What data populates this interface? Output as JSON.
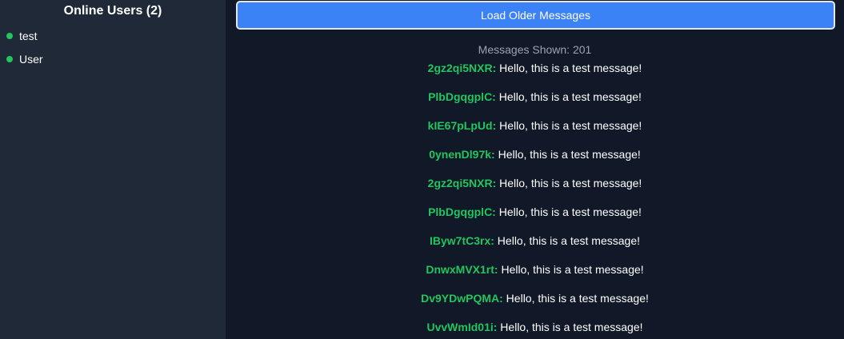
{
  "sidebar": {
    "title": "Online Users (2)",
    "users": [
      "test",
      "User"
    ]
  },
  "main": {
    "load_button_label": "Load Older Messages",
    "count_label": "Messages Shown: 201",
    "messages": [
      {
        "sender": "2gz2qi5NXR:",
        "text": " Hello, this is a test message!"
      },
      {
        "sender": "PlbDgqgplC:",
        "text": " Hello, this is a test message!"
      },
      {
        "sender": "kIE67pLpUd:",
        "text": " Hello, this is a test message!"
      },
      {
        "sender": "0ynenDl97k:",
        "text": " Hello, this is a test message!"
      },
      {
        "sender": "2gz2qi5NXR:",
        "text": " Hello, this is a test message!"
      },
      {
        "sender": "PlbDgqgplC:",
        "text": " Hello, this is a test message!"
      },
      {
        "sender": "IByw7tC3rx:",
        "text": " Hello, this is a test message!"
      },
      {
        "sender": "DnwxMVX1rt:",
        "text": " Hello, this is a test message!"
      },
      {
        "sender": "Dv9YDwPQMA:",
        "text": " Hello, this is a test message!"
      },
      {
        "sender": "UvvWmId01i:",
        "text": " Hello, this is a test message!"
      }
    ]
  },
  "colors": {
    "sidebar_bg": "#1f2937",
    "main_bg": "#111827",
    "accent": "#3b82f6",
    "online": "#22c55e"
  }
}
